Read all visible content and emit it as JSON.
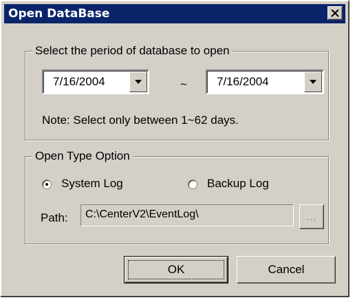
{
  "window": {
    "title": "Open DataBase",
    "close_glyph": "✕"
  },
  "period_group": {
    "label": "Select the period of database to open",
    "start_date": "7/16/2004",
    "separator": "~",
    "end_date": "7/16/2004",
    "note": "Note: Select only between 1~62 days."
  },
  "type_group": {
    "label": "Open Type Option",
    "options": [
      {
        "label": "System Log",
        "selected": true
      },
      {
        "label": "Backup Log",
        "selected": false
      }
    ],
    "path_label": "Path:",
    "path_value": "C:\\CenterV2\\EventLog\\",
    "browse_label": "..."
  },
  "buttons": {
    "ok_label": "OK",
    "cancel_label": "Cancel"
  },
  "colors": {
    "titlebar": "#0a246a",
    "face": "#d4d0c8"
  }
}
